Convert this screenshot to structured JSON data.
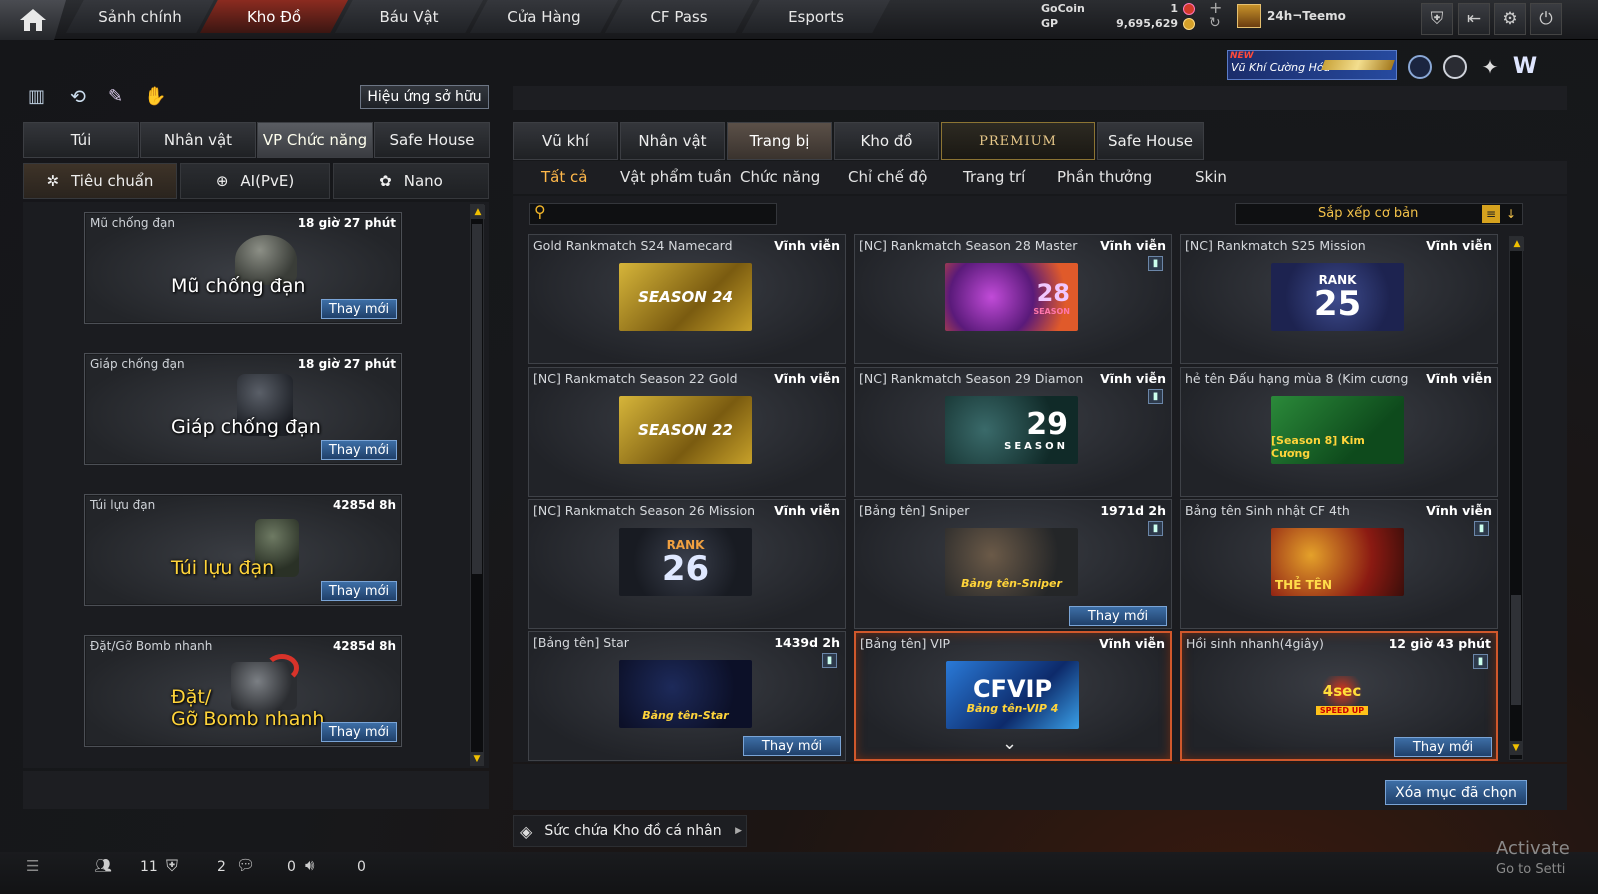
{
  "topnav": {
    "tabs": [
      "Sảnh chính",
      "Kho Đồ",
      "Báu Vật",
      "Cửa Hàng",
      "CF Pass",
      "Esports"
    ],
    "active": "Kho Đồ",
    "gocoin_label": "GoCoin",
    "gocoin_value": "1",
    "gp_label": "GP",
    "gp_value": "9,695,629",
    "username": "24h¬Teemo",
    "plus": "+"
  },
  "banner": {
    "new": "NEW",
    "text": "Vũ Khí Cường Hóa"
  },
  "left": {
    "effect_button": "Hiệu ứng sở hữu",
    "tabs": [
      "Túi",
      "Nhân vật",
      "VP Chức năng",
      "Safe House"
    ],
    "active_tab": "VP Chức năng",
    "subtabs": [
      "Tiêu chuẩn",
      "AI(PvE)",
      "Nano"
    ],
    "active_subtab": "Tiêu chuẩn",
    "items": [
      {
        "name": "Mũ chống đạn",
        "time": "18 giờ 27 phút",
        "overlay": "Mũ chống đạn",
        "button": "Thay mới"
      },
      {
        "name": "Giáp chống đạn",
        "time": "18 giờ 27 phút",
        "overlay": "Giáp chống đạn",
        "button": "Thay mới"
      },
      {
        "name": "Túi lựu đạn",
        "time": "4285d 8h",
        "overlay": "Túi lựu đạn",
        "button": "Thay mới"
      },
      {
        "name": "Đặt/Gỡ Bomb nhanh",
        "time": "4285d 8h",
        "overlay_1": "Đặt/",
        "overlay_2": "Gỡ Bomb nhanh",
        "button": "Thay mới"
      }
    ]
  },
  "right": {
    "tabs": [
      "Vũ khí",
      "Nhân vật",
      "Trang bị",
      "Kho đồ",
      "PREMIUM",
      "Safe House"
    ],
    "active_tab": "Trang bị",
    "subtabs": [
      "Tất cả",
      "Vật phẩm tuần",
      "Chức năng",
      "Chỉ chế độ",
      "Trang trí",
      "Phần thưởng",
      "Skin"
    ],
    "active_subtab": "Tất cả",
    "search_placeholder": "",
    "sort_label": "Sắp xếp cơ bản",
    "items": [
      {
        "name": "Gold Rankmatch S24 Namecard",
        "time": "Vĩnh viễn",
        "img_text": "SEASON 24"
      },
      {
        "name": "[NC] Rankmatch Season 28 Master",
        "time": "Vĩnh viễn",
        "img_text": "28",
        "img_sub": "SEASON"
      },
      {
        "name": "[NC] Rankmatch S25 Mission",
        "time": "Vĩnh viễn",
        "img_top": "RANK",
        "img_text": "25"
      },
      {
        "name": "[NC] Rankmatch Season 22 Gold",
        "time": "Vĩnh viễn",
        "img_text": "SEASON 22"
      },
      {
        "name": "[NC] Rankmatch Season 29 Diamon",
        "time": "Vĩnh viễn",
        "img_text": "29",
        "img_sub": "SEASON"
      },
      {
        "name": "hẻ tên Đấu hạng mùa 8 (Kim cương",
        "time": "Vĩnh viễn",
        "img_text": "[Season 8] Kim Cương"
      },
      {
        "name": "[NC] Rankmatch Season 26 Mission",
        "time": "Vĩnh viễn",
        "img_top": "RANK",
        "img_text": "26"
      },
      {
        "name": "[Bảng tên] Sniper",
        "time": "1971d 2h",
        "img_text": "Bảng tên-Sniper",
        "button": "Thay mới"
      },
      {
        "name": "Bảng tên Sinh nhật CF 4th",
        "time": "Vĩnh viễn",
        "img_text": "THẺ TÊN"
      },
      {
        "name": "[Bảng tên] Star",
        "time": "1439d 2h",
        "img_text": "Bảng tên-Star",
        "button": "Thay mới"
      },
      {
        "name": "[Bảng tên] VIP",
        "time": "Vĩnh viễn",
        "img_top": "CFVIP",
        "img_text": "Bảng tên-VIP 4"
      },
      {
        "name": "Hồi sinh nhanh(4giây)",
        "time": "12 giờ 43 phút",
        "img_top": "4sec",
        "img_text": "SPEED UP",
        "button": "Thay mới"
      }
    ],
    "delete_button": "Xóa mục đã chọn",
    "capacity_label": "Sức chứa Kho đồ cá nhân"
  },
  "statusbar": {
    "counts": [
      "11",
      "2",
      "0",
      "0"
    ]
  },
  "watermark": {
    "line1": "Activate",
    "line2": "Go to Setti"
  }
}
